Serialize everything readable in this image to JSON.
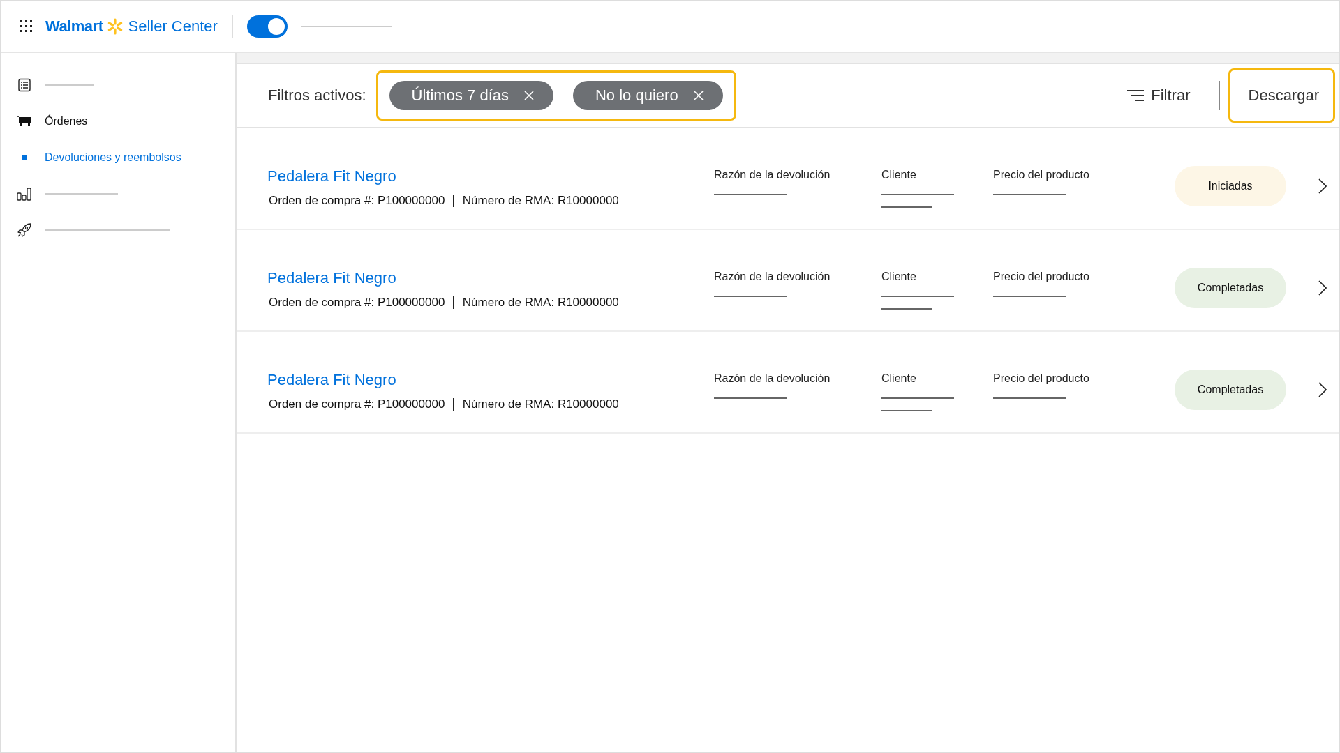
{
  "header": {
    "brand": "Walmart",
    "product": "Seller Center",
    "toggle": {
      "on": true
    }
  },
  "sidebar": {
    "items": [
      {
        "selected": false
      },
      {
        "label": "Órdenes",
        "selected": false,
        "children": [
          {
            "label": "Devoluciones y reembolsos",
            "selected": true
          }
        ]
      },
      {
        "selected": false
      },
      {
        "selected": false
      }
    ]
  },
  "filter_bar": {
    "label": "Filtros activos:",
    "highlighted": true,
    "chips": [
      {
        "label": "Últimos 7 días"
      },
      {
        "label": "No lo quiero"
      }
    ],
    "filter_button": "Filtrar",
    "download_button": {
      "label": "Descargar",
      "highlighted": true
    }
  },
  "returns": [
    {
      "title": "Pedalera Fit Negro",
      "order": "Orden de compra #: P100000000",
      "rma": "Número de RMA: R10000000",
      "columns": [
        "Razón de la devolución",
        "Cliente",
        "Precio del producto"
      ],
      "status": {
        "label": "Iniciadas",
        "kind": "started"
      }
    },
    {
      "title": "Pedalera Fit Negro",
      "order": "Orden de compra #: P100000000",
      "rma": "Número de RMA: R10000000",
      "columns": [
        "Razón de la devolución",
        "Cliente",
        "Precio del producto"
      ],
      "status": {
        "label": "Completadas",
        "kind": "completed"
      }
    },
    {
      "title": "Pedalera Fit Negro",
      "order": "Orden de compra #: P100000000",
      "rma": "Número de RMA: R10000000",
      "columns": [
        "Razón de la devolución",
        "Cliente",
        "Precio del producto"
      ],
      "status": {
        "label": "Completadas",
        "kind": "completed"
      }
    }
  ]
}
